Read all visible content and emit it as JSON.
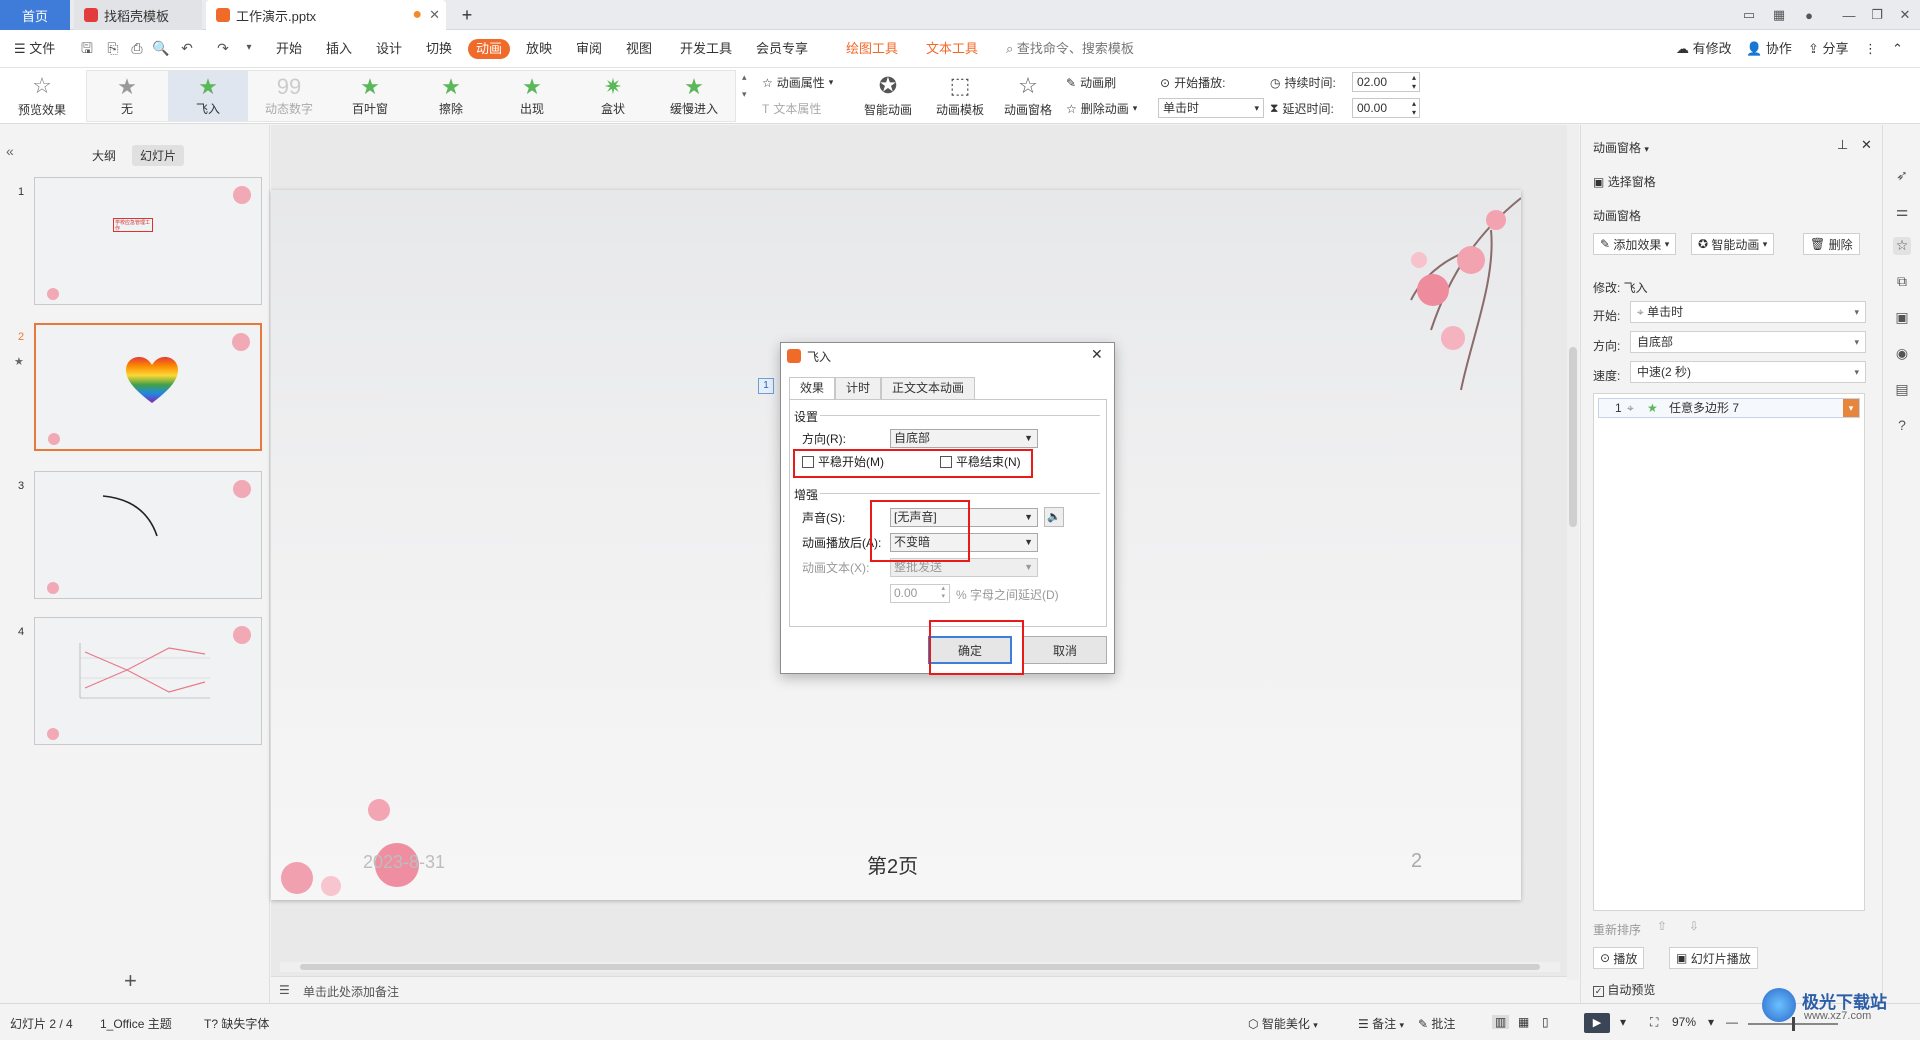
{
  "tabs": {
    "home": "首页",
    "template": "找稻壳模板",
    "doc": "工作演示.pptx",
    "new_tab": "+"
  },
  "menu": {
    "file": "文件",
    "items": [
      "开始",
      "插入",
      "设计",
      "切换",
      "动画",
      "放映",
      "审阅",
      "视图",
      "开发工具",
      "会员专享"
    ],
    "active": "动画",
    "tool_tabs": [
      "绘图工具",
      "文本工具"
    ],
    "search": "查找命令、搜索模板",
    "right": [
      "有修改",
      "协作",
      "分享"
    ]
  },
  "ribbon": {
    "preview": "预览效果",
    "gallery": [
      "无",
      "飞入",
      "动态数字",
      "百叶窗",
      "擦除",
      "出现",
      "盒状",
      "缓慢进入"
    ],
    "anim_props": "动画属性",
    "text_props": "文本属性",
    "smart_anim": "智能动画",
    "anim_template": "动画模板",
    "anim_pane": "动画窗格",
    "anim_brush": "动画刷",
    "delete_anim": "删除动画",
    "start_play": "开始播放:",
    "start_value": "单击时",
    "duration_label": "持续时间:",
    "duration_value": "02.00",
    "delay_label": "延迟时间:",
    "delay_value": "00.00"
  },
  "left_panel": {
    "tab_outline": "大纲",
    "tab_slides": "幻灯片",
    "slides": [
      {
        "num": "1",
        "title": "学校应急管理工作"
      },
      {
        "num": "2"
      },
      {
        "num": "3"
      },
      {
        "num": "4"
      }
    ],
    "add": "+"
  },
  "slide": {
    "date": "2023-8-31",
    "page_label": "第2页",
    "page_num": "2",
    "anim_tag": "1"
  },
  "notes_placeholder": "单击此处添加备注",
  "dialog": {
    "title": "飞入",
    "tabs": [
      "效果",
      "计时",
      "正文文本动画"
    ],
    "section_settings": "设置",
    "direction_label": "方向(R):",
    "direction_value": "自底部",
    "smooth_start": "平稳开始(M)",
    "smooth_end": "平稳结束(N)",
    "section_enhance": "增强",
    "sound_label": "声音(S):",
    "sound_value": "[无声音]",
    "after_label": "动画播放后(A):",
    "after_value": "不变暗",
    "text_anim_label": "动画文本(X):",
    "text_anim_value": "整批发送",
    "delay_value": "0.00",
    "delay_suffix": "% 字母之间延迟(D)",
    "ok": "确定",
    "cancel": "取消"
  },
  "right_panel": {
    "title": "动画窗格",
    "select_pane": "选择窗格",
    "section": "动画窗格",
    "add_effect": "添加效果",
    "smart_anim": "智能动画",
    "delete": "删除",
    "modify": "修改: 飞入",
    "start_label": "开始:",
    "start_value": "单击时",
    "direction_label": "方向:",
    "direction_value": "自底部",
    "speed_label": "速度:",
    "speed_value": "中速(2 秒)",
    "list_item": {
      "num": "1",
      "name": "任意多边形 7"
    },
    "reorder": "重新排序",
    "play": "播放",
    "slideshow": "幻灯片播放",
    "auto_preview": "自动预览"
  },
  "status": {
    "slide_info": "幻灯片 2 / 4",
    "theme": "1_Office 主题",
    "missing_font": "缺失字体",
    "beautify": "智能美化",
    "notes": "备注",
    "comments": "批注",
    "zoom": "97%"
  },
  "watermark": "极光下载站",
  "watermark_url": "www.xz7.com",
  "colors": {
    "accent": "#f06a2a",
    "highlight": "#e81a1a",
    "primary": "#3c7fd8"
  }
}
